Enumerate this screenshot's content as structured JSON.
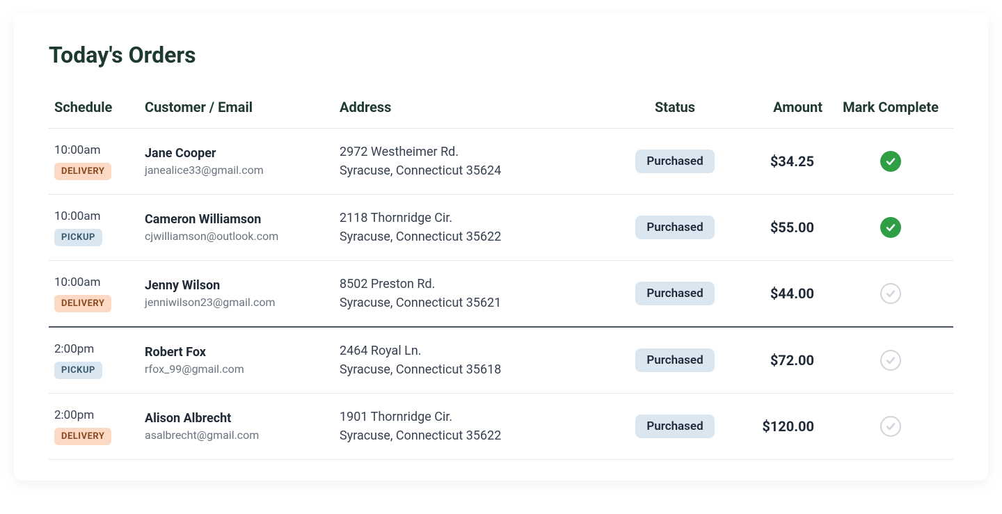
{
  "title": "Today's Orders",
  "columns": {
    "schedule": "Schedule",
    "customer": "Customer / Email",
    "address": "Address",
    "status": "Status",
    "amount": "Amount",
    "complete": "Mark Complete"
  },
  "orders": [
    {
      "time": "10:00am",
      "type": "DELIVERY",
      "name": "Jane Cooper",
      "email": "janealice33@gmail.com",
      "addr1": "2972 Westheimer Rd.",
      "addr2": "Syracuse, Connecticut 35624",
      "status": "Purchased",
      "amount": "$34.25",
      "complete": true,
      "heavy": false
    },
    {
      "time": "10:00am",
      "type": "PICKUP",
      "name": "Cameron Williamson",
      "email": "cjwilliamson@outlook.com",
      "addr1": "2118 Thornridge Cir.",
      "addr2": "Syracuse, Connecticut 35622",
      "status": "Purchased",
      "amount": "$55.00",
      "complete": true,
      "heavy": false
    },
    {
      "time": "10:00am",
      "type": "DELIVERY",
      "name": "Jenny Wilson",
      "email": "jenniwilson23@gmail.com",
      "addr1": "8502 Preston Rd.",
      "addr2": "Syracuse, Connecticut 35621",
      "status": "Purchased",
      "amount": "$44.00",
      "complete": false,
      "heavy": true
    },
    {
      "time": "2:00pm",
      "type": "PICKUP",
      "name": "Robert Fox",
      "email": "rfox_99@gmail.com",
      "addr1": "2464 Royal Ln.",
      "addr2": "Syracuse, Connecticut 35618",
      "status": "Purchased",
      "amount": "$72.00",
      "complete": false,
      "heavy": false
    },
    {
      "time": "2:00pm",
      "type": "DELIVERY",
      "name": "Alison Albrecht",
      "email": "asalbrecht@gmail.com",
      "addr1": "1901 Thornridge Cir.",
      "addr2": "Syracuse, Connecticut 35622",
      "status": "Purchased",
      "amount": "$120.00",
      "complete": false,
      "heavy": false
    }
  ]
}
